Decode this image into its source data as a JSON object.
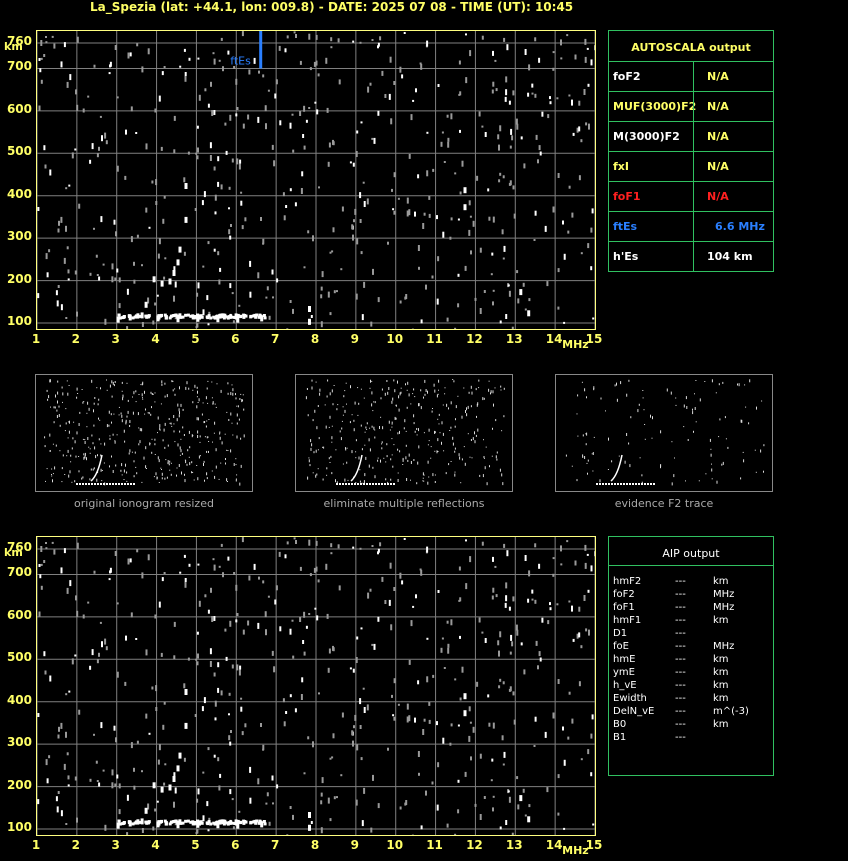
{
  "header": {
    "title": "La_Spezia (lat: +44.1, lon: 009.8) - DATE: 2025 07 08 - TIME (UT): 10:45"
  },
  "colors": {
    "tick": "#ffff66",
    "grid": "#808080",
    "panel_border": "#30c060",
    "fes": "#2a7fff",
    "fof1": "#ff2020",
    "trace": "#ffffff"
  },
  "chart_data": [
    {
      "type": "scatter",
      "name": "ionogram-top",
      "xlabel": "MHz",
      "ylabel": "km",
      "xlim": [
        1,
        15
      ],
      "ylim": [
        100,
        760
      ],
      "xticks": [
        "1",
        "2",
        "3",
        "4",
        "5",
        "6",
        "7",
        "8",
        "9",
        "10",
        "11",
        "12",
        "13",
        "14",
        "15"
      ],
      "yticks": [
        "760",
        "700",
        "600",
        "500",
        "400",
        "300",
        "200",
        "100"
      ],
      "grid": true,
      "annotations": [
        {
          "text": "ftEs",
          "x": 6.6
        }
      ],
      "fes_marker": {
        "x": 6.6,
        "y_from": 700,
        "y_to": 760
      },
      "trace": [
        {
          "x": 3.0,
          "y": 115
        },
        {
          "x": 3.3,
          "y": 120
        },
        {
          "x": 3.6,
          "y": 125
        },
        {
          "x": 4.0,
          "y": 118
        },
        {
          "x": 4.5,
          "y": 116
        },
        {
          "x": 5.0,
          "y": 117
        },
        {
          "x": 5.5,
          "y": 116
        },
        {
          "x": 6.0,
          "y": 115
        },
        {
          "x": 6.6,
          "y": 118
        },
        {
          "x": 3.7,
          "y": 150
        },
        {
          "x": 3.9,
          "y": 210
        },
        {
          "x": 4.1,
          "y": 200
        },
        {
          "x": 4.3,
          "y": 205
        },
        {
          "x": 4.4,
          "y": 225
        },
        {
          "x": 4.5,
          "y": 250
        },
        {
          "x": 4.55,
          "y": 280
        },
        {
          "x": 4.7,
          "y": 350
        },
        {
          "x": 4.7,
          "y": 430
        },
        {
          "x": 7.8,
          "y": 140
        },
        {
          "x": 7.8,
          "y": 110
        },
        {
          "x": 11.7,
          "y": 380
        },
        {
          "x": 11.7,
          "y": 420
        },
        {
          "x": 13.1,
          "y": 180
        },
        {
          "x": 13.3,
          "y": 130
        }
      ]
    },
    {
      "type": "scatter",
      "name": "ionogram-bottom",
      "xlabel": "MHz",
      "ylabel": "km",
      "xlim": [
        1,
        15
      ],
      "ylim": [
        100,
        760
      ],
      "xticks": [
        "1",
        "2",
        "3",
        "4",
        "5",
        "6",
        "7",
        "8",
        "9",
        "10",
        "11",
        "12",
        "13",
        "14",
        "15"
      ],
      "yticks": [
        "760",
        "700",
        "600",
        "500",
        "400",
        "300",
        "200",
        "100"
      ],
      "grid": true
    }
  ],
  "thumbnails": [
    {
      "caption": "original ionogram resized"
    },
    {
      "caption": "eliminate multiple reflections"
    },
    {
      "caption": "evidence F2 trace"
    }
  ],
  "autoscala": {
    "title": "AUTOSCALA output",
    "rows": [
      {
        "label": "foF2",
        "value": "N/A",
        "label_color": "#ffffff",
        "value_color": "#ffff66"
      },
      {
        "label": "MUF(3000)F2",
        "value": "N/A",
        "label_color": "#ffff66",
        "value_color": "#ffff66"
      },
      {
        "label": "M(3000)F2",
        "value": "N/A",
        "label_color": "#ffffff",
        "value_color": "#ffff66"
      },
      {
        "label": "fxI",
        "value": "N/A",
        "label_color": "#ffff66",
        "value_color": "#ffff66"
      },
      {
        "label": "foF1",
        "value": "N/A",
        "label_color": "#ff2020",
        "value_color": "#ff2020"
      },
      {
        "label": "ftEs",
        "value": "6.6  MHz",
        "label_color": "#2a7fff",
        "value_color": "#2a7fff"
      },
      {
        "label": "h'Es",
        "value": "104     km",
        "label_color": "#ffffff",
        "value_color": "#ffffff"
      }
    ]
  },
  "aip": {
    "title": "AIP output",
    "rows": [
      {
        "name": "hmF2",
        "dash": "---",
        "unit": "km"
      },
      {
        "name": "foF2",
        "dash": "---",
        "unit": "MHz"
      },
      {
        "name": "foF1",
        "dash": "---",
        "unit": "MHz"
      },
      {
        "name": "hmF1",
        "dash": "---",
        "unit": "km"
      },
      {
        "name": "D1",
        "dash": "---",
        "unit": ""
      },
      {
        "name": "foE",
        "dash": "---",
        "unit": "MHz"
      },
      {
        "name": "hmE",
        "dash": "---",
        "unit": "km"
      },
      {
        "name": "ymE",
        "dash": "---",
        "unit": "km"
      },
      {
        "name": "h_vE",
        "dash": "---",
        "unit": "km"
      },
      {
        "name": "Ewidth",
        "dash": "---",
        "unit": "km"
      },
      {
        "name": "DelN_vE",
        "dash": "---",
        "unit": "m^(-3)"
      },
      {
        "name": "B0",
        "dash": "---",
        "unit": "km"
      },
      {
        "name": "B1",
        "dash": "---",
        "unit": ""
      }
    ]
  }
}
